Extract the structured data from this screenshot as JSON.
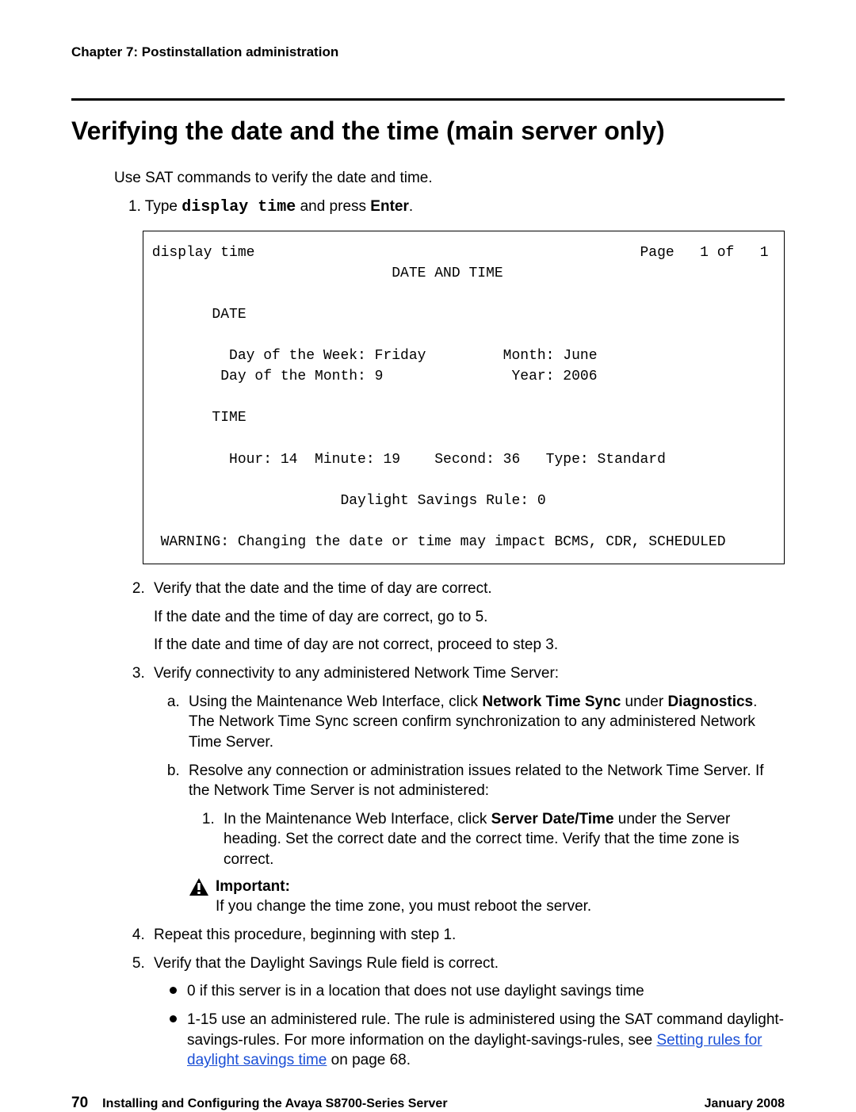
{
  "chapter_label": "Chapter 7: Postinstallation administration",
  "section_title": "Verifying the date and the time (main server only)",
  "intro": "Use SAT commands to verify the date and time.",
  "step1_prefix": "1. Type ",
  "step1_cmd": "display time",
  "step1_mid": " and press ",
  "step1_enter": "Enter",
  "step1_suffix": ".",
  "terminal": " display time                                             Page   1 of   1\n                             DATE AND TIME\n\n        DATE\n\n          Day of the Week: Friday         Month: June\n         Day of the Month: 9               Year: 2006\n\n        TIME\n\n          Hour: 14  Minute: 19    Second: 36   Type: Standard\n\n                       Daylight Savings Rule: 0\n\n  WARNING: Changing the date or time may impact BCMS, CDR, SCHEDULED",
  "steps": {
    "s2_a": "Verify that the date and the time of day are correct.",
    "s2_b": "If the date and the time of day are correct, go to 5.",
    "s2_c": "If the date and time of day are not correct, proceed to step 3.",
    "s3": "Verify connectivity to any administered Network Time Server:",
    "s3a_pre": "Using the Maintenance Web Interface, click ",
    "s3a_b1": "Network Time Sync",
    "s3a_mid": " under ",
    "s3a_b2": "Diagnostics",
    "s3a_post": ". The Network Time Sync screen confirm synchronization to any administered Network Time Server.",
    "s3b": "Resolve any connection or administration issues related to the Network Time Server. If the Network Time Server is not administered:",
    "s3b1_pre": "In the Maintenance Web Interface, click ",
    "s3b1_b": "Server Date/Time",
    "s3b1_post": " under the Server heading. Set the correct date and the correct time. Verify that the time zone is correct.",
    "important_label": "Important:",
    "important_body": "If you change the time zone, you must reboot the server.",
    "s4": "Repeat this procedure, beginning with step 1.",
    "s5": "Verify that the Daylight Savings Rule field is correct.",
    "s5_b1": "0 if this server is in a location that does not use daylight savings time",
    "s5_b2_pre": "1-15 use an administered rule. The rule is administered using the SAT command daylight-savings-rules. For more information on the daylight-savings-rules, see ",
    "s5_b2_link": "Setting rules for daylight savings time",
    "s5_b2_post": " on page 68."
  },
  "footer": {
    "pagenum": "70",
    "title": "Installing and Configuring the Avaya S8700-Series Server",
    "date": "January 2008"
  }
}
